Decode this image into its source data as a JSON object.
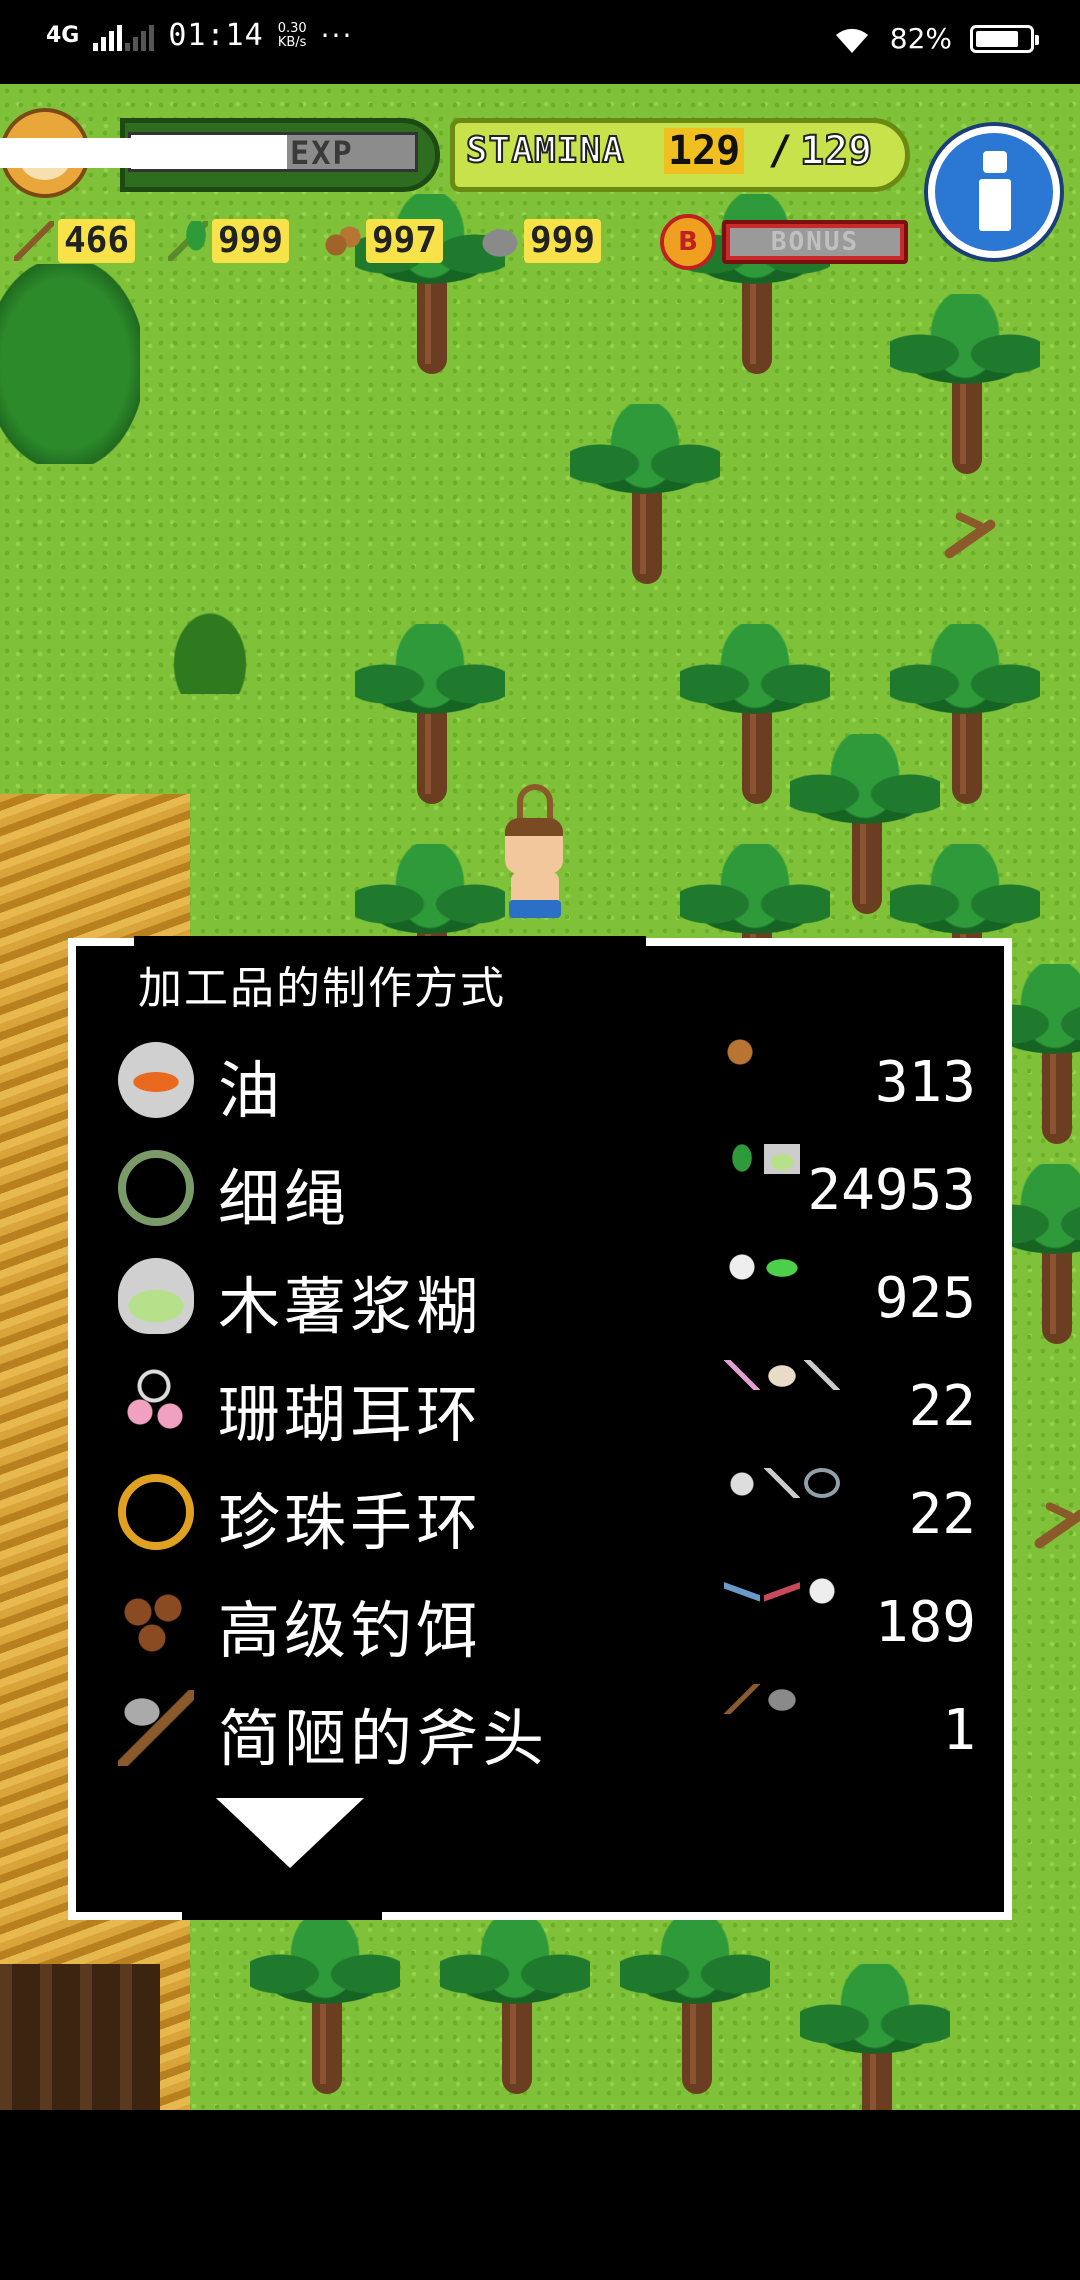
{
  "status_bar": {
    "network": "4G",
    "time": "01:14",
    "speed_value": "0.30",
    "speed_unit": "KB/s",
    "more": "···",
    "battery_pct": "82%",
    "battery_level": 0.82
  },
  "hud": {
    "exp_label": "EXP",
    "exp_fill": 0.55,
    "stamina_label": "STAMINA",
    "stamina_current": "129",
    "stamina_sep": "/",
    "stamina_max": "129",
    "bonus_coin": "B",
    "bonus_label": "BONUS",
    "resources": [
      {
        "icon": "branch-icon",
        "value": "466"
      },
      {
        "icon": "sprout-icon",
        "value": "999"
      },
      {
        "icon": "nuts-icon",
        "value": "997"
      },
      {
        "icon": "stone-icon",
        "value": "999"
      }
    ]
  },
  "panel": {
    "title": "加工品的制作方式",
    "recipes": [
      {
        "name": "油",
        "icon": "oil-icon",
        "materials": [
          "nut-icon"
        ],
        "count": "313"
      },
      {
        "name": "细绳",
        "icon": "rope-icon",
        "materials": [
          "sprout-icon",
          "bowl-icon"
        ],
        "count": "24953"
      },
      {
        "name": "木薯浆糊",
        "icon": "paste-icon",
        "materials": [
          "flower-icon",
          "green-paste-icon"
        ],
        "count": "925"
      },
      {
        "name": "珊瑚耳环",
        "icon": "earring-icon",
        "materials": [
          "coral-icon",
          "shell-icon",
          "fishbone-icon"
        ],
        "count": "22"
      },
      {
        "name": "珍珠手环",
        "icon": "bracelet-icon",
        "materials": [
          "pearl-icon",
          "fishbone-icon",
          "hook-icon"
        ],
        "count": "22"
      },
      {
        "name": "高级钓饵",
        "icon": "bait-icon",
        "materials": [
          "worm-icon",
          "red-worm-icon",
          "flower-icon"
        ],
        "count": "189"
      },
      {
        "name": "简陋的斧头",
        "icon": "axe-icon",
        "materials": [
          "branch-icon",
          "stone-icon"
        ],
        "count": "1"
      }
    ],
    "scroll_indicator": "scroll-down-arrow-icon"
  }
}
